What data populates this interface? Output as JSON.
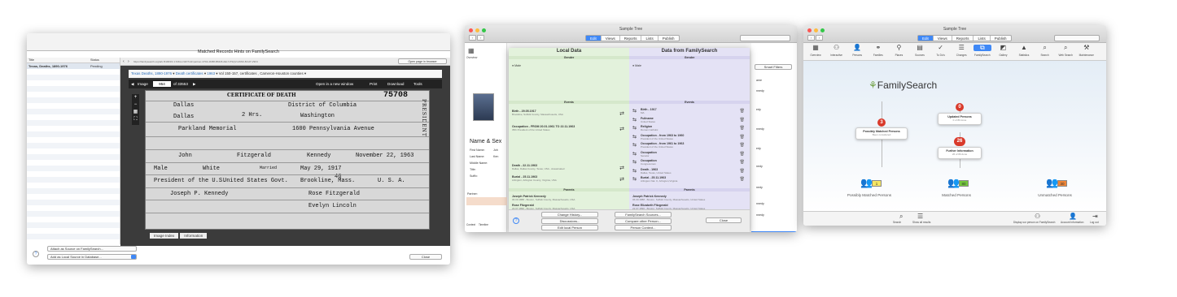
{
  "w1": {
    "title": "Sample Tree",
    "tabs": [
      "Edit",
      "Views",
      "Reports",
      "Lists",
      "Publish"
    ],
    "active": "Edit",
    "sheet_title": "Matched Records Hints on FamilySearch",
    "cols": [
      "Title",
      "Status"
    ],
    "row": {
      "title": "Texas, Deaths, 1890-1976",
      "status": "Pending"
    },
    "url": "https://familysearch.org/ark:/61903/1:1:K3GL-N2C?cid=partner-47DA-3D88-BMC8-2EL7-PSQV-HNSK-8CHT-V9FC",
    "open_page": "Open page in browser",
    "crumb": [
      "Texas Deaths, 1890-1976",
      "Death certificates",
      "1963",
      "Vol 150-157, certificates , Cameron-Houston counties"
    ],
    "image_label": "Image",
    "image_num": "954",
    "image_of": "of 33553",
    "tools": [
      "Open in a new window",
      "Print",
      "Download",
      "Tools"
    ],
    "cert": {
      "heading": "CERTIFICATE OF DEATH",
      "state_file": "75708",
      "county": "Dallas",
      "city": "Dallas",
      "district": "District of Columbia",
      "city2": "Washington",
      "hospital": "Parkland Memorial",
      "address": "1600 Pennsylvania Avenue",
      "stay": "2 Hrs.",
      "first": "John",
      "middle": "Fitzgerald",
      "last": "Kennedy",
      "date_death": "November 22, 1963",
      "sex": "Male",
      "color": "White",
      "married": "Married",
      "birth": "May 29, 1917",
      "age": "46",
      "occupation": "President of the U.S.",
      "business": "United States Govt.",
      "birthplace": "Brookline, Mass.",
      "citizen": "U. S. A.",
      "father": "Joseph P. Kennedy",
      "mother": "Rose Fitzgerald",
      "informant": "Evelyn Lincoln",
      "side": "PRESIDENT"
    },
    "index_tabs": [
      "Image Index",
      "Information"
    ],
    "attach": "Attach as Source on FamilySearch...",
    "add_local": "Add as Local Source in Database...",
    "close": "Close",
    "help": "?"
  },
  "w2": {
    "title": "Sample Tree",
    "tabs": [
      "Edit",
      "Views",
      "Reports",
      "Lists",
      "Publish"
    ],
    "active": "Edit",
    "local": "Local Data",
    "fs": "Data from FamilySearch",
    "sections": {
      "gender": "Gender",
      "events": "Events",
      "parents": "Parents",
      "partner": "Partner"
    },
    "male": "Male",
    "left_events": [
      {
        "t": "Birth - 29.05.1917",
        "s": "Brookline, Suffolk County, Massachusetts, USA"
      },
      {
        "t": "Occupation - FROM 20.01.1961 TO 22.11.1963",
        "s": "35th President of the United States"
      },
      {
        "t": "Death - 22.11.1963",
        "s": "Dallas, Dallas County, Texas, USA - Assasinated"
      },
      {
        "t": "Burial - 25.11.1963",
        "s": "Arlington, Arlington County, Virginia, USA"
      }
    ],
    "right_events": [
      {
        "t": "Birth - 1917",
        "s": "MA"
      },
      {
        "t": "Fullname",
        "s": "United States"
      },
      {
        "t": "Religion",
        "s": "Roman Catholic"
      },
      {
        "t": "Occupation - from 1963 to 1960",
        "s": "President of the United States"
      },
      {
        "t": "Occupation - from 1961 to 1963",
        "s": "President of the United States"
      },
      {
        "t": "Occupation",
        "s": "Senator"
      },
      {
        "t": "Occupation",
        "s": "Congressman"
      },
      {
        "t": "Death - 1963",
        "s": "Dallas, Texas, United States"
      },
      {
        "t": "Burial - 25.11.1963",
        "s": "Arlington Nat. C, Arlington,Virginia"
      }
    ],
    "left_parents": [
      {
        "t": "Joseph Patrick Kennedy",
        "s": "06.09.1888 - Boston, Suffolk County, Massachusetts, USA"
      },
      {
        "t": "Rose Fitzgerald",
        "s": "22.07.1890 - Boston, Suffolk County, Massachusetts, USA"
      }
    ],
    "right_parents": [
      {
        "t": "Joseph Patrick Kennedy",
        "s": "06.09.1888 - Boston, Suffolk County, Massachusetts, United States"
      },
      {
        "t": "Rose Elizabeth Fitzgerald",
        "s": "22.07.1890 - Boston, Suffolk County, Massachusetts, United States"
      }
    ],
    "partner_left": "Jacqueline Bouvier",
    "partner_right": "Jacqueline Bouvier",
    "buttons": [
      "Change History...",
      "FamilySearch Sources...",
      "Discussions...",
      "Compare other Person...",
      "Edit local Person",
      "Person Context..."
    ],
    "close": "Close",
    "bg": {
      "overview": "Overview",
      "smart": "Smart Filters",
      "name_sex": "Name & Sex",
      "fields": [
        "First Name:",
        "Last Name:",
        "Middle Name:",
        "Title:",
        "Suffix:"
      ],
      "first_short": "Joh",
      "last_short": "Ken",
      "partner": "Partner:",
      "footer": [
        "Context",
        "Timeline",
        "Pa..."
      ],
      "persons": [
        "nnedy",
        "edy",
        "nnedy",
        "edy",
        "nedy",
        "nedy",
        "nnedy",
        "nnedy",
        "edy"
      ],
      "name_col": "ame"
    }
  },
  "w3": {
    "title": "Sample Tree",
    "tabs": [
      "Edit",
      "Views",
      "Reports",
      "Lists",
      "Publish"
    ],
    "active": "Edit",
    "toolbar": [
      {
        "l": "Overview",
        "i": "▦"
      },
      {
        "l": "Interactive",
        "i": "⚇"
      },
      {
        "l": "Persons",
        "i": "👤"
      },
      {
        "l": "Families",
        "i": "⚭"
      },
      {
        "l": "Places",
        "i": "⚲"
      },
      {
        "l": "Sources",
        "i": "▤"
      },
      {
        "l": "To Do's",
        "i": "✓"
      },
      {
        "l": "Changes",
        "i": "☰"
      },
      {
        "l": "FamilySearch",
        "i": "⧉"
      },
      {
        "l": "Gallery",
        "i": "◩"
      },
      {
        "l": "Statistics",
        "i": "▲"
      },
      {
        "l": "Search",
        "i": "⌕"
      },
      {
        "l": "Web Search",
        "i": "⌕"
      },
      {
        "l": "Maintenance",
        "i": "⚒"
      }
    ],
    "logo": "FamilySearch",
    "nodes": {
      "pm": {
        "count": "3",
        "title": "Possibly Matched Persons",
        "sub": "Been considered"
      },
      "up": {
        "count": "0",
        "title": "Updated Persons",
        "sub": "0 of 80 done"
      },
      "fi": {
        "count": "26",
        "title": "Further Information",
        "sub": "26 of 80 done"
      }
    },
    "groups": [
      {
        "label": "Possibly Matched Persons",
        "count": "1",
        "color": "#f5e663"
      },
      {
        "label": "Matched Persons",
        "count": "80",
        "color": "#73c63b"
      },
      {
        "label": "Unmatched Persons",
        "count": "30",
        "color": "#ef8536"
      }
    ],
    "bottom": [
      "Search",
      "Show all results",
      "Display our person on FamilySearch",
      "Account Information",
      "Log out"
    ]
  }
}
